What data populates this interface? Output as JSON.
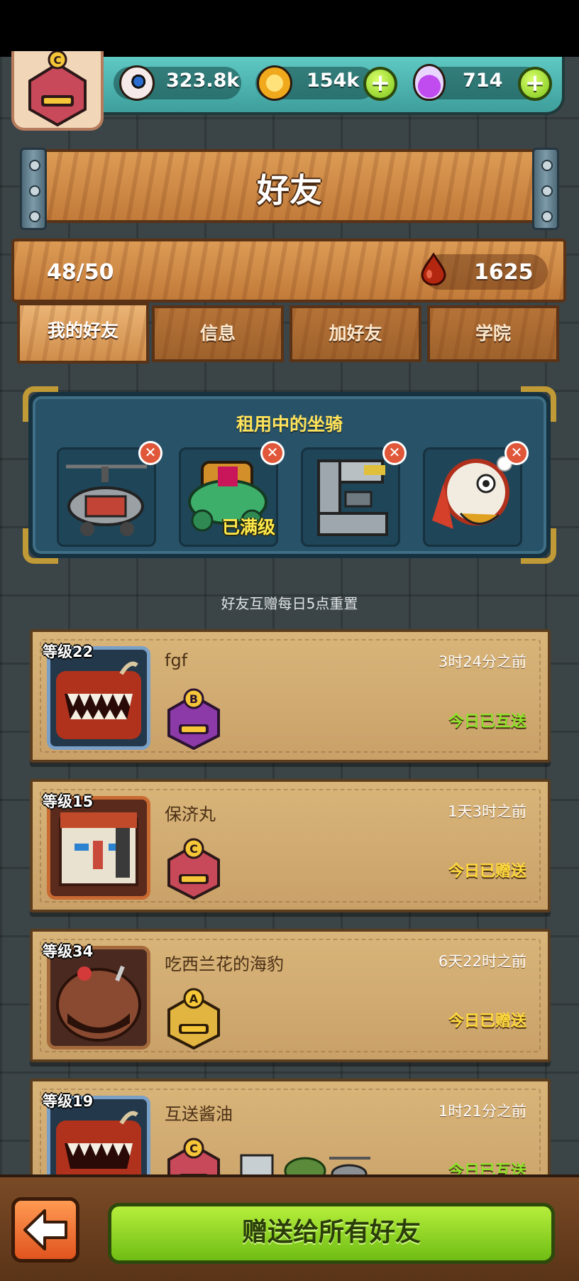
{
  "header": {
    "rank_letter": "C",
    "eyeball_count": "323.8k",
    "coin_count": "154k",
    "potion_count": "714"
  },
  "page": {
    "title": "好友",
    "friend_count": "48/50",
    "blood_count": "1625"
  },
  "tabs": [
    {
      "label": "我的好友",
      "active": true
    },
    {
      "label": "信息",
      "active": false
    },
    {
      "label": "加好友",
      "active": false
    },
    {
      "label": "学院",
      "active": false
    }
  ],
  "rental": {
    "title": "租用中的坐骑",
    "slots": [
      {
        "icon": "helicopter-mount-icon",
        "badge": ""
      },
      {
        "icon": "green-throne-mount-icon",
        "badge": "已满级"
      },
      {
        "icon": "grey-machine-mount-icon",
        "badge": ""
      },
      {
        "icon": "lion-dance-mount-icon",
        "badge": ""
      }
    ]
  },
  "reset_note": "好友互赠每日5点重置",
  "friends": [
    {
      "level": "等级22",
      "name": "fgf",
      "last_seen": "3时24分之前",
      "status": "今日已互送",
      "rank": "B",
      "status_color": "#8ee22a"
    },
    {
      "level": "等级15",
      "name": "保济丸",
      "last_seen": "1天3时之前",
      "status": "今日已赠送",
      "rank": "C",
      "status_color": "#ffd93a"
    },
    {
      "level": "等级34",
      "name": "吃西兰花的海豹",
      "last_seen": "6天22时之前",
      "status": "今日已赠送",
      "rank": "A",
      "status_color": "#ffd93a"
    },
    {
      "level": "等级19",
      "name": "互送酱油",
      "last_seen": "1时21分之前",
      "status": "今日已互送",
      "rank": "C",
      "status_color": "#8ee22a"
    }
  ],
  "footer": {
    "gift_all_label": "赠送给所有好友"
  }
}
